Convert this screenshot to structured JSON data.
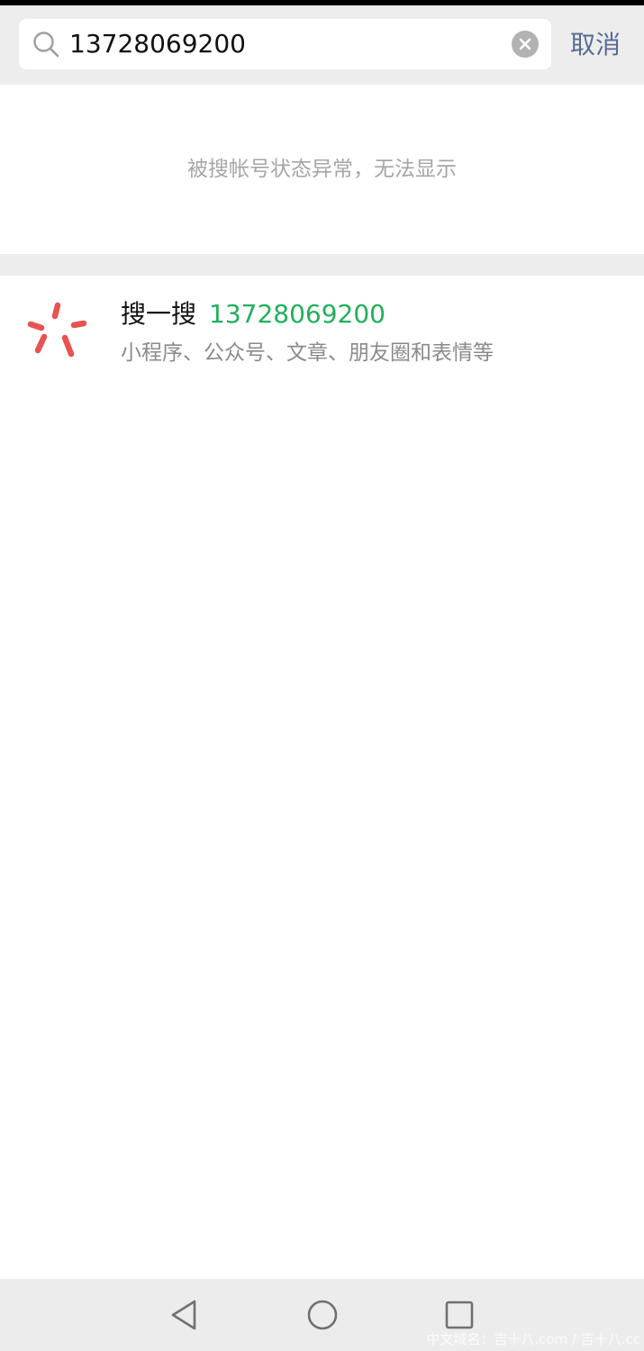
{
  "search": {
    "query": "13728069200",
    "cancel_label": "取消"
  },
  "notice": {
    "text": "被搜帐号状态异常，无法显示"
  },
  "souyisou": {
    "title": "搜一搜",
    "keyword": "13728069200",
    "description": "小程序、公众号、文章、朋友圈和表情等",
    "icon": "souyisou-logo-icon",
    "icon_color": "#e8524f"
  },
  "colors": {
    "header_bg": "#ededed",
    "link_blue": "#576b95",
    "keyword_green": "#20b05a",
    "muted_text": "#a6a6a6"
  },
  "watermark": {
    "text": "中文域名：吉十八.com / 吉十八.cc"
  }
}
